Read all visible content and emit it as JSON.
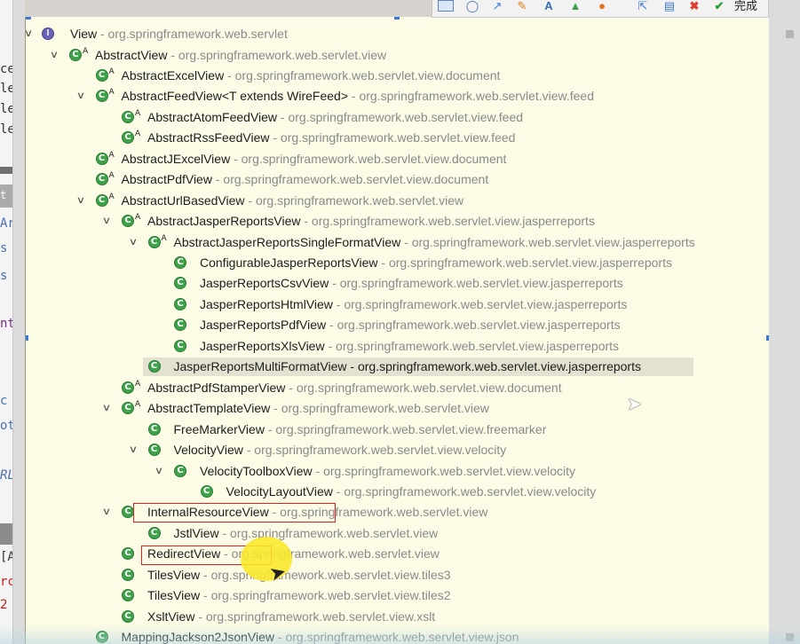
{
  "left_editor": {
    "fragments": [
      "ce",
      "le",
      "le",
      "le",
      "t",
      "Ar",
      "s",
      "s",
      "nt",
      "c",
      "ot",
      "RL",
      "[A",
      "rc",
      "2"
    ]
  },
  "toolbar": {
    "icons": [
      "select-rect-icon",
      "ellipse-icon",
      "arrow-icon",
      "pen-icon",
      "text-icon",
      "image-icon",
      "color-palette-icon",
      "export-icon",
      "save-icon",
      "close-icon",
      "check-icon"
    ],
    "done_label": "完成"
  },
  "hierarchy": {
    "root": {
      "name": "View",
      "package": " - org.springframework.web.servlet"
    },
    "rows": [
      {
        "name": "AbstractView",
        "package": " - org.springframework.web.servlet.view"
      },
      {
        "name": "AbstractExcelView",
        "package": " - org.springframework.web.servlet.view.document"
      },
      {
        "name": "AbstractFeedView<T extends WireFeed>",
        "package": " - org.springframework.web.servlet.view.feed"
      },
      {
        "name": "AbstractAtomFeedView",
        "package": " - org.springframework.web.servlet.view.feed"
      },
      {
        "name": "AbstractRssFeedView",
        "package": " - org.springframework.web.servlet.view.feed"
      },
      {
        "name": "AbstractJExcelView",
        "package": " - org.springframework.web.servlet.view.document"
      },
      {
        "name": "AbstractPdfView",
        "package": " - org.springframework.web.servlet.view.document"
      },
      {
        "name": "AbstractUrlBasedView",
        "package": " - org.springframework.web.servlet.view"
      },
      {
        "name": "AbstractJasperReportsView",
        "package": " - org.springframework.web.servlet.view.jasperreports"
      },
      {
        "name": "AbstractJasperReportsSingleFormatView",
        "package": " - org.springframework.web.servlet.view.jasperreports"
      },
      {
        "name": "ConfigurableJasperReportsView",
        "package": " - org.springframework.web.servlet.view.jasperreports"
      },
      {
        "name": "JasperReportsCsvView",
        "package": " - org.springframework.web.servlet.view.jasperreports"
      },
      {
        "name": "JasperReportsHtmlView",
        "package": " - org.springframework.web.servlet.view.jasperreports"
      },
      {
        "name": "JasperReportsPdfView",
        "package": " - org.springframework.web.servlet.view.jasperreports"
      },
      {
        "name": "JasperReportsXlsView",
        "package": " - org.springframework.web.servlet.view.jasperreports"
      },
      {
        "name": "JasperReportsMultiFormatView",
        "package": " - org.springframework.web.servlet.view.jasperreports"
      },
      {
        "name": "AbstractPdfStamperView",
        "package": " - org.springframework.web.servlet.view.document"
      },
      {
        "name": "AbstractTemplateView",
        "package": " - org.springframework.web.servlet.view"
      },
      {
        "name": "FreeMarkerView",
        "package": " - org.springframework.web.servlet.view.freemarker"
      },
      {
        "name": "VelocityView",
        "package": " - org.springframework.web.servlet.view.velocity"
      },
      {
        "name": "VelocityToolboxView",
        "package": " - org.springframework.web.servlet.view.velocity"
      },
      {
        "name": "VelocityLayoutView",
        "package": " - org.springframework.web.servlet.view.velocity"
      },
      {
        "name": "InternalResourceView",
        "package": " - org.springframework.web.servlet.view"
      },
      {
        "name": "JstlView",
        "package": " - org.springframework.web.servlet.view"
      },
      {
        "name": "RedirectView",
        "package": " - org.springframework.web.servlet.view"
      },
      {
        "name": "TilesView",
        "package": " - org.springframework.web.servlet.view.tiles3"
      },
      {
        "name": "TilesView",
        "package": " - org.springframework.web.servlet.view.tiles2"
      },
      {
        "name": "XsltView",
        "package": " - org.springframework.web.servlet.view.xslt"
      },
      {
        "name": "MappingJackson2JsonView",
        "package": " - org.springframework.web.servlet.view.json"
      }
    ]
  },
  "colors": {
    "popup_bg": "#fbfbe6",
    "class_icon": "#3fa24b",
    "annotation_red": "#e2201c",
    "highlighter_yellow": "#fce828"
  }
}
